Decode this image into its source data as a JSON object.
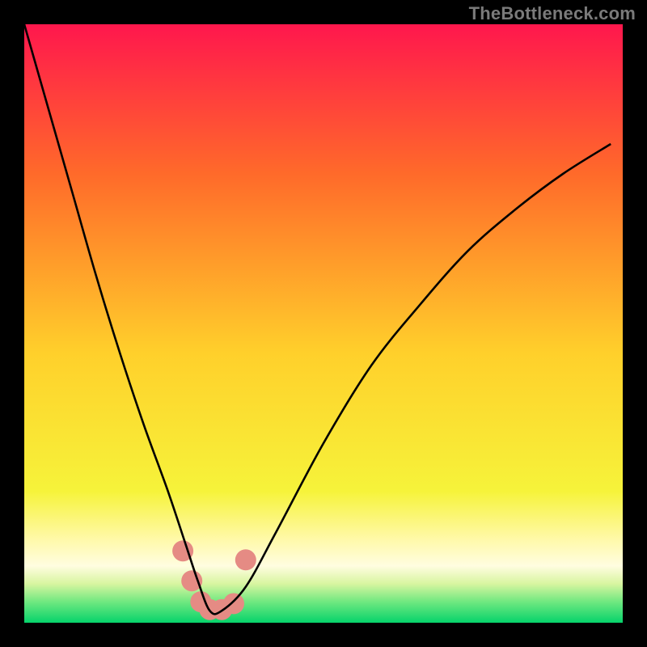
{
  "watermark": "TheBottleneck.com",
  "chart_data": {
    "type": "line",
    "title": "",
    "xlabel": "",
    "ylabel": "",
    "xlim": [
      0,
      100
    ],
    "ylim": [
      0,
      100
    ],
    "grid": false,
    "legend": false,
    "gradient_stops": [
      {
        "offset": 0,
        "color": "#ff174d"
      },
      {
        "offset": 0.25,
        "color": "#ff6a2a"
      },
      {
        "offset": 0.55,
        "color": "#ffd02b"
      },
      {
        "offset": 0.78,
        "color": "#f6f33a"
      },
      {
        "offset": 0.86,
        "color": "#fff9a8"
      },
      {
        "offset": 0.905,
        "color": "#fffde0"
      },
      {
        "offset": 0.935,
        "color": "#d8f5a0"
      },
      {
        "offset": 0.965,
        "color": "#70e880"
      },
      {
        "offset": 1.0,
        "color": "#06d36b"
      }
    ],
    "series": [
      {
        "name": "bottleneck-curve",
        "x": [
          0,
          4,
          8,
          12,
          16,
          20,
          24,
          27,
          29,
          31,
          33,
          37,
          42,
          50,
          58,
          66,
          74,
          82,
          90,
          98
        ],
        "values": [
          100,
          86,
          72,
          58,
          45,
          33,
          22,
          13,
          7,
          2,
          2,
          6,
          15,
          30,
          43,
          53,
          62,
          69,
          75,
          80
        ]
      }
    ],
    "markers": {
      "name": "highlight-dots",
      "color": "#e58b84",
      "points": [
        {
          "x": 26.5,
          "y": 12
        },
        {
          "x": 28.0,
          "y": 7
        },
        {
          "x": 29.5,
          "y": 3.5
        },
        {
          "x": 31.0,
          "y": 2.2
        },
        {
          "x": 33.0,
          "y": 2.2
        },
        {
          "x": 35.0,
          "y": 3.2
        },
        {
          "x": 37.0,
          "y": 10.5
        }
      ]
    }
  }
}
